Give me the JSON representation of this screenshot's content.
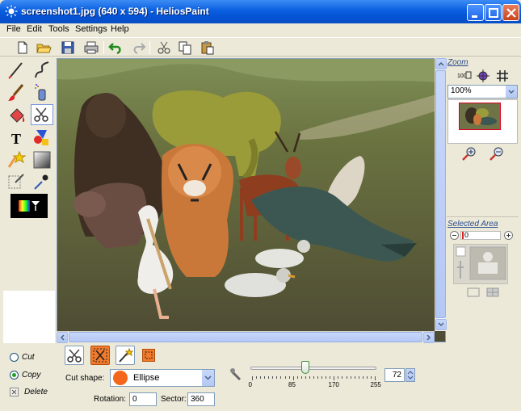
{
  "window": {
    "title": "screenshot1.jpg (640 x 594) - HeliosPaint",
    "accent": "#0a5fe0"
  },
  "menu": [
    "File",
    "Edit",
    "Tools",
    "Settings",
    "Help"
  ],
  "toolbar": {
    "icons": [
      "new-file-icon",
      "open-folder-icon",
      "save-icon",
      "print-icon",
      "undo-icon",
      "redo-icon",
      "cut-icon",
      "copy-icon",
      "paste-icon"
    ]
  },
  "tools": [
    "pencil-icon",
    "curve-icon",
    "brush-icon",
    "fill-bucket-icon",
    "eraser-icon",
    "scissors-cut-icon",
    "text-icon",
    "shapes-icon",
    "sparkle-icon",
    "gradient-icon",
    "clone-icon",
    "eyedropper-icon"
  ],
  "right_panel": {
    "zoom_title": "Zoom",
    "zoom_value": "100%",
    "selected_area_title": "Selected Area",
    "selected_area_value": "0"
  },
  "bottom": {
    "cut_label": "Cut",
    "copy_label": "Copy",
    "delete_label": "Delete",
    "mode_selected": "Copy",
    "cut_shape_label": "Cut shape:",
    "cut_shape_value": "Ellipse",
    "cut_shape_color": "#f4661b",
    "rotation_label": "Rotation:",
    "rotation_value": "0",
    "sector_label": "Sector:",
    "sector_value": "360",
    "slider_value": 72,
    "slider_max": 255,
    "slider_ticks": [
      "0",
      "85",
      "170",
      "255"
    ],
    "spin_value": "72"
  },
  "image_subject": "Collage of animals on a grassy hillside: bear, elephant, tiger, warthog, antelope, falcon, crocodile, pelican, ducks"
}
